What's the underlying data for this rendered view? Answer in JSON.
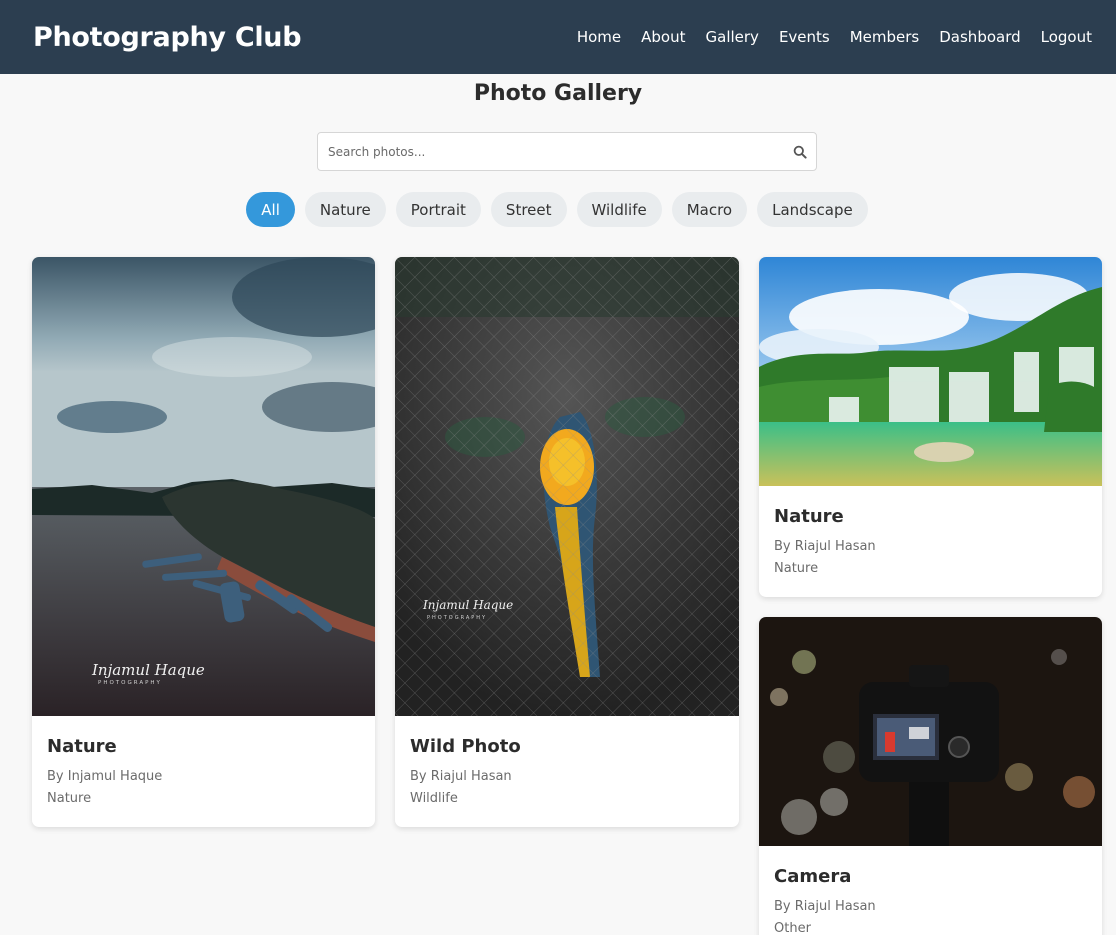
{
  "nav": {
    "brand": "Photography Club",
    "links": [
      "Home",
      "About",
      "Gallery",
      "Events",
      "Members",
      "Dashboard",
      "Logout"
    ]
  },
  "gallery": {
    "title": "Photo Gallery",
    "search_placeholder": "Search photos...",
    "filters": [
      "All",
      "Nature",
      "Portrait",
      "Street",
      "Wildlife",
      "Macro",
      "Landscape"
    ],
    "active_filter": "All"
  },
  "photos": [
    {
      "title": "Nature",
      "author": "By Injamul Haque",
      "category": "Nature",
      "watermark": "Injamul Haque",
      "watermark_sub": "PHOTOGRAPHY"
    },
    {
      "title": "Wild Photo",
      "author": "By Riajul Hasan",
      "category": "Wildlife",
      "watermark": "Injamul Haque",
      "watermark_sub": "PHOTOGRAPHY"
    },
    {
      "title": "Nature",
      "author": "By Riajul Hasan",
      "category": "Nature"
    },
    {
      "title": "Camera",
      "author": "By Riajul Hasan",
      "category": "Other"
    }
  ],
  "colors": {
    "navbar": "#2c3e50",
    "accent": "#3498db",
    "chip": "#e9ecee",
    "background": "#f8f8f8"
  }
}
